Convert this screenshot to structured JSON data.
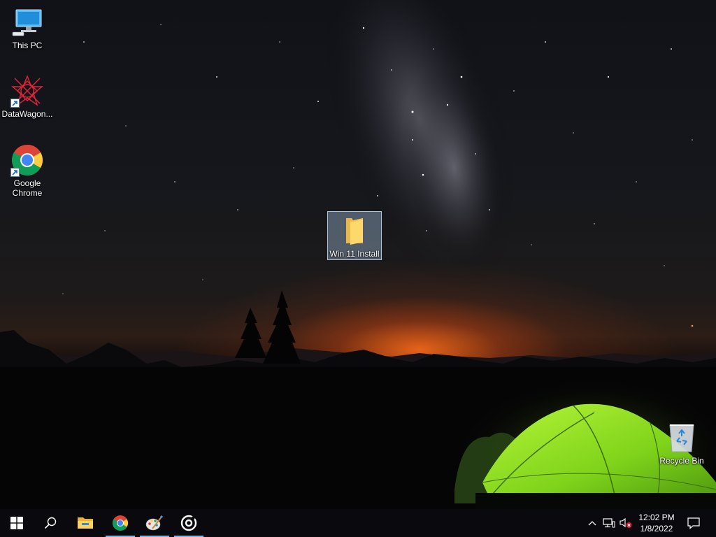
{
  "desktop": {
    "icons": [
      {
        "label": "This PC"
      },
      {
        "label": "DataWagon..."
      },
      {
        "label": "Google Chrome"
      },
      {
        "label": "Win 11 Install"
      },
      {
        "label": "Recycle Bin"
      }
    ]
  },
  "taskbar": {
    "start": "windows-start-icon",
    "search": "search-icon",
    "pinned": [
      "file-explorer-icon",
      "chrome-icon",
      "paint-icon",
      "media-player-icon"
    ],
    "tray": {
      "time": "12:02 PM",
      "date": "1/8/2022"
    }
  },
  "colors": {
    "accent": "#76b9ed",
    "taskbar": "#0a0a0e",
    "tent": "#8ee01c"
  }
}
